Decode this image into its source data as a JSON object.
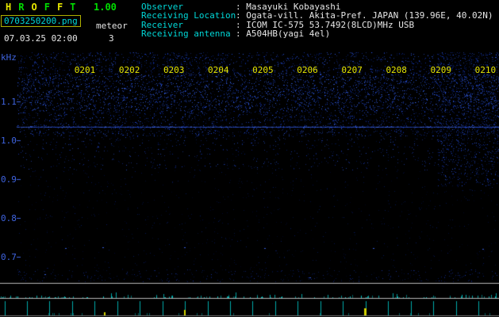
{
  "app": {
    "name_letters": [
      {
        "ch": "H",
        "color": "#e6e600"
      },
      {
        "ch": "R",
        "color": "#00dd00"
      },
      {
        "ch": "O",
        "color": "#e6e600"
      },
      {
        "ch": "F",
        "color": "#00dd00"
      },
      {
        "ch": "F",
        "color": "#e6e600"
      },
      {
        "ch": "T",
        "color": "#00dd00"
      }
    ],
    "version": "1.00",
    "filename": "0703250200.png",
    "mode": "meteor",
    "datetime": "07.03.25 02:00",
    "meteor_count": "3"
  },
  "station_info": {
    "rows": [
      {
        "label": "Observer",
        "value": ": Masayuki Kobayashi"
      },
      {
        "label": "Receiving Location",
        "value": ": Ogata-vill. Akita-Pref. JAPAN (139.96E, 40.02N)"
      },
      {
        "label": "Receiver",
        "value": ": ICOM IC-575 53.7492(8LCD)MHz USB"
      },
      {
        "label": "Receiving antenna",
        "value": ": A504HB(yagi 4el)"
      }
    ]
  },
  "spectrogram": {
    "y_unit": "kHz",
    "freq_labels": [
      "1.1",
      "1.0",
      "0.9",
      "0.8",
      "0.7"
    ],
    "time_labels": [
      "0201",
      "0202",
      "0203",
      "0204",
      "0205",
      "0206",
      "0207",
      "0208",
      "0209",
      "0210"
    ]
  },
  "chart_data": {
    "type": "heatmap",
    "title": "HROFFT radio meteor spectrogram (10 min)",
    "x": [
      "0201",
      "0202",
      "0203",
      "0204",
      "0205",
      "0206",
      "0207",
      "0208",
      "0209",
      "0210"
    ],
    "ylabel": "kHz",
    "y_ticks": [
      1.1,
      1.0,
      0.9,
      0.8,
      0.7
    ],
    "ylim": [
      0.65,
      1.17
    ],
    "features": {
      "carrier_line_khz": 1.03,
      "dense_noise_band_khz": [
        1.03,
        1.17
      ],
      "sparse_noise_below_khz": 1.03,
      "echo_dot_row_khz": 0.73,
      "yellow_event_marks_near": [
        "0203",
        "0207"
      ]
    },
    "legend_position": "none",
    "grid": false
  },
  "colors": {
    "background": "#000000",
    "cyan": "#00d8d8",
    "yellow": "#e6e600",
    "green": "#00dd00",
    "white": "#e6e6e6",
    "axis_blue": "#3f64e0",
    "noise_blue": "#1e44d2",
    "carrier_blue": "#4a75ff",
    "strip_line_gray": "#b8b8b8",
    "tick_cyan": "#00c8c8",
    "event_yellow": "#d4d400"
  }
}
